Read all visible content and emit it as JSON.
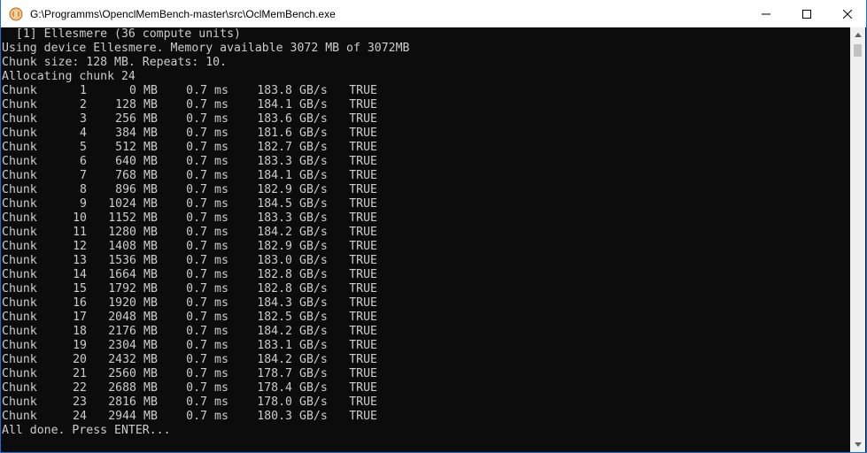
{
  "window": {
    "title": "G:\\Programms\\OpenclMemBench-master\\src\\OclMemBench.exe",
    "icon": "console-app-icon",
    "controls": [
      "minimize-icon",
      "maximize-icon",
      "close-icon"
    ]
  },
  "console": {
    "header_lines": [
      "  [1] Ellesmere (36 compute units)",
      "Using device Ellesmere. Memory available 3072 MB of 3072MB",
      "Chunk size: 128 MB. Repeats: 10.",
      "Allocating chunk 24"
    ],
    "rows": [
      {
        "label": "Chunk",
        "idx": "1",
        "mb": "0",
        "mb_unit": "MB",
        "ms": "0.7",
        "ms_unit": "ms",
        "bw": "183.8",
        "bw_unit": "GB/s",
        "status": "TRUE"
      },
      {
        "label": "Chunk",
        "idx": "2",
        "mb": "128",
        "mb_unit": "MB",
        "ms": "0.7",
        "ms_unit": "ms",
        "bw": "184.1",
        "bw_unit": "GB/s",
        "status": "TRUE"
      },
      {
        "label": "Chunk",
        "idx": "3",
        "mb": "256",
        "mb_unit": "MB",
        "ms": "0.7",
        "ms_unit": "ms",
        "bw": "183.6",
        "bw_unit": "GB/s",
        "status": "TRUE"
      },
      {
        "label": "Chunk",
        "idx": "4",
        "mb": "384",
        "mb_unit": "MB",
        "ms": "0.7",
        "ms_unit": "ms",
        "bw": "181.6",
        "bw_unit": "GB/s",
        "status": "TRUE"
      },
      {
        "label": "Chunk",
        "idx": "5",
        "mb": "512",
        "mb_unit": "MB",
        "ms": "0.7",
        "ms_unit": "ms",
        "bw": "182.7",
        "bw_unit": "GB/s",
        "status": "TRUE"
      },
      {
        "label": "Chunk",
        "idx": "6",
        "mb": "640",
        "mb_unit": "MB",
        "ms": "0.7",
        "ms_unit": "ms",
        "bw": "183.3",
        "bw_unit": "GB/s",
        "status": "TRUE"
      },
      {
        "label": "Chunk",
        "idx": "7",
        "mb": "768",
        "mb_unit": "MB",
        "ms": "0.7",
        "ms_unit": "ms",
        "bw": "184.1",
        "bw_unit": "GB/s",
        "status": "TRUE"
      },
      {
        "label": "Chunk",
        "idx": "8",
        "mb": "896",
        "mb_unit": "MB",
        "ms": "0.7",
        "ms_unit": "ms",
        "bw": "182.9",
        "bw_unit": "GB/s",
        "status": "TRUE"
      },
      {
        "label": "Chunk",
        "idx": "9",
        "mb": "1024",
        "mb_unit": "MB",
        "ms": "0.7",
        "ms_unit": "ms",
        "bw": "184.5",
        "bw_unit": "GB/s",
        "status": "TRUE"
      },
      {
        "label": "Chunk",
        "idx": "10",
        "mb": "1152",
        "mb_unit": "MB",
        "ms": "0.7",
        "ms_unit": "ms",
        "bw": "183.3",
        "bw_unit": "GB/s",
        "status": "TRUE"
      },
      {
        "label": "Chunk",
        "idx": "11",
        "mb": "1280",
        "mb_unit": "MB",
        "ms": "0.7",
        "ms_unit": "ms",
        "bw": "184.2",
        "bw_unit": "GB/s",
        "status": "TRUE"
      },
      {
        "label": "Chunk",
        "idx": "12",
        "mb": "1408",
        "mb_unit": "MB",
        "ms": "0.7",
        "ms_unit": "ms",
        "bw": "182.9",
        "bw_unit": "GB/s",
        "status": "TRUE"
      },
      {
        "label": "Chunk",
        "idx": "13",
        "mb": "1536",
        "mb_unit": "MB",
        "ms": "0.7",
        "ms_unit": "ms",
        "bw": "183.0",
        "bw_unit": "GB/s",
        "status": "TRUE"
      },
      {
        "label": "Chunk",
        "idx": "14",
        "mb": "1664",
        "mb_unit": "MB",
        "ms": "0.7",
        "ms_unit": "ms",
        "bw": "182.8",
        "bw_unit": "GB/s",
        "status": "TRUE"
      },
      {
        "label": "Chunk",
        "idx": "15",
        "mb": "1792",
        "mb_unit": "MB",
        "ms": "0.7",
        "ms_unit": "ms",
        "bw": "182.8",
        "bw_unit": "GB/s",
        "status": "TRUE"
      },
      {
        "label": "Chunk",
        "idx": "16",
        "mb": "1920",
        "mb_unit": "MB",
        "ms": "0.7",
        "ms_unit": "ms",
        "bw": "184.3",
        "bw_unit": "GB/s",
        "status": "TRUE"
      },
      {
        "label": "Chunk",
        "idx": "17",
        "mb": "2048",
        "mb_unit": "MB",
        "ms": "0.7",
        "ms_unit": "ms",
        "bw": "182.5",
        "bw_unit": "GB/s",
        "status": "TRUE"
      },
      {
        "label": "Chunk",
        "idx": "18",
        "mb": "2176",
        "mb_unit": "MB",
        "ms": "0.7",
        "ms_unit": "ms",
        "bw": "184.2",
        "bw_unit": "GB/s",
        "status": "TRUE"
      },
      {
        "label": "Chunk",
        "idx": "19",
        "mb": "2304",
        "mb_unit": "MB",
        "ms": "0.7",
        "ms_unit": "ms",
        "bw": "183.1",
        "bw_unit": "GB/s",
        "status": "TRUE"
      },
      {
        "label": "Chunk",
        "idx": "20",
        "mb": "2432",
        "mb_unit": "MB",
        "ms": "0.7",
        "ms_unit": "ms",
        "bw": "184.2",
        "bw_unit": "GB/s",
        "status": "TRUE"
      },
      {
        "label": "Chunk",
        "idx": "21",
        "mb": "2560",
        "mb_unit": "MB",
        "ms": "0.7",
        "ms_unit": "ms",
        "bw": "178.7",
        "bw_unit": "GB/s",
        "status": "TRUE"
      },
      {
        "label": "Chunk",
        "idx": "22",
        "mb": "2688",
        "mb_unit": "MB",
        "ms": "0.7",
        "ms_unit": "ms",
        "bw": "178.4",
        "bw_unit": "GB/s",
        "status": "TRUE"
      },
      {
        "label": "Chunk",
        "idx": "23",
        "mb": "2816",
        "mb_unit": "MB",
        "ms": "0.7",
        "ms_unit": "ms",
        "bw": "178.0",
        "bw_unit": "GB/s",
        "status": "TRUE"
      },
      {
        "label": "Chunk",
        "idx": "24",
        "mb": "2944",
        "mb_unit": "MB",
        "ms": "0.7",
        "ms_unit": "ms",
        "bw": "180.3",
        "bw_unit": "GB/s",
        "status": "TRUE"
      }
    ],
    "footer_line": "All done. Press ENTER..."
  },
  "scrollbar": {
    "up_icon": "scroll-up-arrow-icon",
    "down_icon": "scroll-down-arrow-icon"
  },
  "colors": {
    "console_bg": "#0c0c0c",
    "console_text": "#cccccc",
    "titlebar_bg": "#ffffff",
    "window_border": "#1e6fd0"
  }
}
